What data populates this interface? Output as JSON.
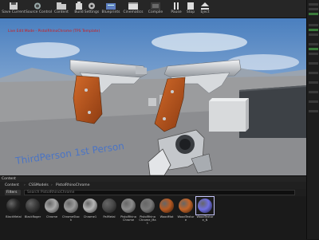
{
  "toolbar": {
    "buttons": [
      {
        "label": "Save Current",
        "icon": "save-icon"
      },
      {
        "label": "Source Control",
        "icon": "source-control-icon"
      },
      {
        "label": "Content",
        "icon": "content-icon"
      },
      {
        "label": "Build",
        "icon": "build-icon"
      },
      {
        "label": "Settings",
        "icon": "settings-icon"
      },
      {
        "label": "Blueprints",
        "icon": "blueprints-icon"
      },
      {
        "label": "Cinematics",
        "icon": "cinematics-icon"
      },
      {
        "label": "Compile",
        "icon": "compile-icon"
      },
      {
        "label": "Pause",
        "icon": "pause-icon"
      },
      {
        "label": "Stop",
        "icon": "stop-icon"
      },
      {
        "label": "Eject",
        "icon": "eject-icon"
      }
    ]
  },
  "viewport": {
    "debug_text": "Live Edit Mode - PistolRhinoChrome (TPS Template)",
    "floor_text": "ThirdPerson 1st Person"
  },
  "content_browser": {
    "tab": "Content",
    "breadcrumb": [
      "Content",
      "CSSModels",
      "PistolRhinoChrome"
    ],
    "filters_label": "Filters",
    "search_placeholder": "Search PistolRhinoChrome",
    "assets": [
      {
        "name": "BlackMetal",
        "color": "#2a2a2a"
      },
      {
        "name": "BlackRoger",
        "color": "#3a3a3a"
      },
      {
        "name": "Chrome",
        "color": "#a8a8a8"
      },
      {
        "name": "ChromeStock",
        "color": "#9a9a9a"
      },
      {
        "name": "Chrome1",
        "color": "#b5b5b5"
      },
      {
        "name": "PalMetal",
        "color": "#4a4a4a"
      },
      {
        "name": "PistolRhinoChrome",
        "color": "#8c8c8c"
      },
      {
        "name": "PistolRhinoChrome_Mat",
        "color": "#7a7a7a"
      },
      {
        "name": "WoodMat",
        "color": "#b65a23"
      },
      {
        "name": "WoodTexture",
        "color": "#c26428"
      },
      {
        "name": "WoodTexture_N",
        "color": "#6f6fe0"
      }
    ]
  },
  "colors": {
    "accent_debug": "#d21818",
    "wood": "#b8541f",
    "chrome": "#c9ccd0"
  }
}
